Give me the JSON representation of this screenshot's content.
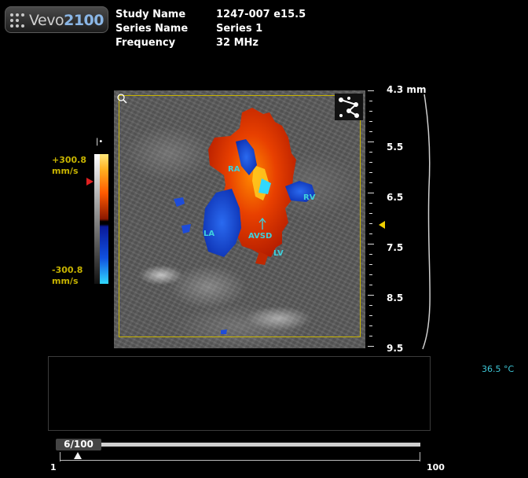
{
  "app": {
    "logo_text": "Vevo",
    "logo_number": "2100"
  },
  "study_info": [
    {
      "key": "Study Name",
      "value": "1247-007 e15.5"
    },
    {
      "key": "Series Name",
      "value": "Series 1"
    },
    {
      "key": "Frequency",
      "value": "32 MHz"
    }
  ],
  "image_labels": {
    "ra": "RA",
    "rv": "RV",
    "la": "LA",
    "avsd": "AVSD",
    "lv": "LV"
  },
  "depth_scale": {
    "unit": "mm",
    "labels": [
      "4.3 mm",
      "5.5",
      "6.5",
      "7.5",
      "8.5",
      "9.5"
    ]
  },
  "color_bar": {
    "max_label": "+300.8",
    "min_label": "-300.8",
    "unit": "mm/s"
  },
  "temperature": "36.5 °C",
  "timeline": {
    "frame_label": "6/100",
    "current_frame": 6,
    "total_frames": 100,
    "min_label": "1",
    "max_label": "100"
  },
  "colors": {
    "roi_border": "#c8b400",
    "label_cyan": "#3ed0dc",
    "accent_yellow": "#c8b400"
  }
}
